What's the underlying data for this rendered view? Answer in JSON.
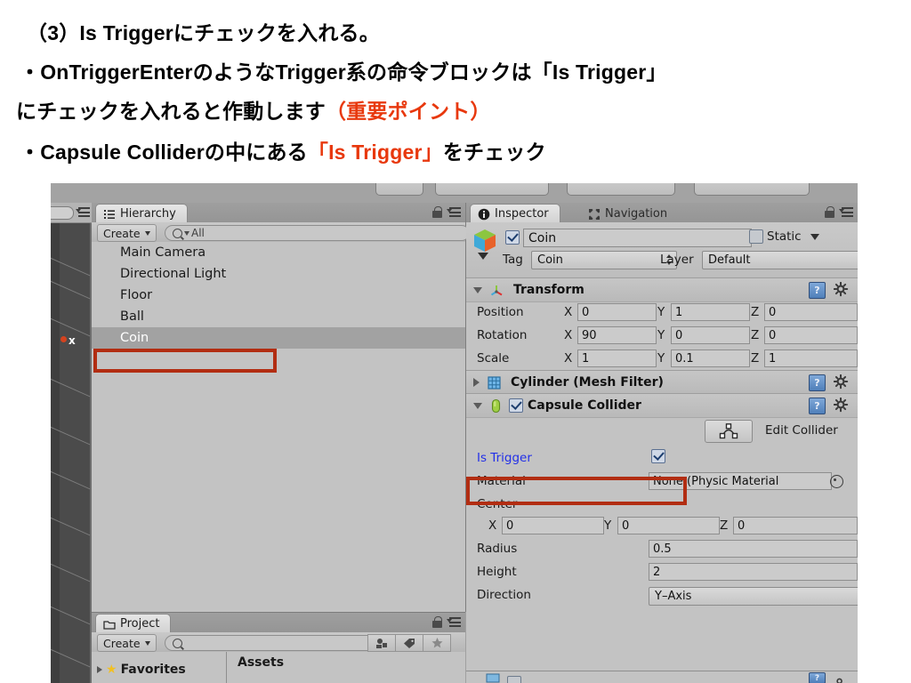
{
  "caption": {
    "line1": "（3）Is Triggerにチェックを入れる。",
    "line2": "・OnTriggerEnterのようなTrigger系の命令ブロックは「Is Trigger」",
    "line3_a": "にチェックを入れると作動します",
    "line3_b": "（重要ポイント）",
    "line4_a": "・Capsule Colliderの中にある",
    "line4_b": "「Is Trigger」",
    "line4_c": "をチェック",
    "accent_color": "#e8380d",
    "text_color": "#000000"
  },
  "annotation": {
    "box_color": "#b22d12"
  },
  "scene": {
    "axis_label": "x"
  },
  "hierarchy": {
    "tab_label": "Hierarchy",
    "tab_icon": "hierarchy-list-icon",
    "create_label": "Create",
    "search_placeholder": "All",
    "search_icon": "search-icon",
    "lock_icon": "lock-icon",
    "menu_icon": "panel-menu-icon",
    "items": [
      {
        "label": "Main Camera",
        "selected": false
      },
      {
        "label": "Directional Light",
        "selected": false
      },
      {
        "label": "Floor",
        "selected": false
      },
      {
        "label": "Ball",
        "selected": false
      },
      {
        "label": "Coin",
        "selected": true
      }
    ]
  },
  "project": {
    "tab_label": "Project",
    "tab_icon": "folder-icon",
    "create_label": "Create",
    "search_placeholder": "",
    "lock_icon": "lock-icon",
    "menu_icon": "panel-menu-icon",
    "favorites_label": "Favorites",
    "assets_label": "Assets",
    "star_icon": "star-icon",
    "toolbar_icons": [
      "filter-by-type-icon",
      "filter-by-label-icon",
      "favorite-star-icon"
    ]
  },
  "inspector": {
    "tab_label": "Inspector",
    "tab_icon": "info-icon",
    "nav_tab_label": "Navigation",
    "nav_tab_icon": "navigation-mesh-icon",
    "lock_icon": "lock-icon",
    "menu_icon": "panel-menu-icon",
    "object": {
      "icon": "gameobject-cube-icon",
      "enabled": true,
      "name": "Coin",
      "static_label": "Static",
      "static_checked": false,
      "tag_label": "Tag",
      "tag_value": "Coin",
      "layer_label": "Layer",
      "layer_value": "Default"
    },
    "transform": {
      "title": "Transform",
      "icon": "transform-axis-icon",
      "expanded": true,
      "help_icon": "help-book-icon",
      "gear_icon": "gear-icon",
      "rows": [
        {
          "label": "Position",
          "x": "0",
          "y": "1",
          "z": "0"
        },
        {
          "label": "Rotation",
          "x": "90",
          "y": "0",
          "z": "0"
        },
        {
          "label": "Scale",
          "x": "1",
          "y": "0.1",
          "z": "1"
        }
      ],
      "axis_x": "X",
      "axis_y": "Y",
      "axis_z": "Z"
    },
    "mesh_filter": {
      "title": "Cylinder (Mesh Filter)",
      "icon": "mesh-filter-icon",
      "expanded": false,
      "help_icon": "help-book-icon",
      "gear_icon": "gear-icon"
    },
    "capsule_collider": {
      "title": "Capsule Collider",
      "icon": "capsule-collider-icon",
      "expanded": true,
      "enabled": true,
      "help_icon": "help-book-icon",
      "gear_icon": "gear-icon",
      "edit_collider_label": "Edit Collider",
      "edit_collider_icon": "edit-collider-icon",
      "is_trigger_label": "Is Trigger",
      "is_trigger_checked": true,
      "is_trigger_color": "#2330e8",
      "material_label": "Material",
      "material_value": "None (Physic Material",
      "material_picker_icon": "object-picker-icon",
      "center_label": "Center",
      "center_x": "0",
      "center_y": "0",
      "center_z": "0",
      "axis_x": "X",
      "axis_y": "Y",
      "axis_z": "Z",
      "radius_label": "Radius",
      "radius_value": "0.5",
      "height_label": "Height",
      "height_value": "2",
      "direction_label": "Direction",
      "direction_value": "Y–Axis"
    }
  }
}
